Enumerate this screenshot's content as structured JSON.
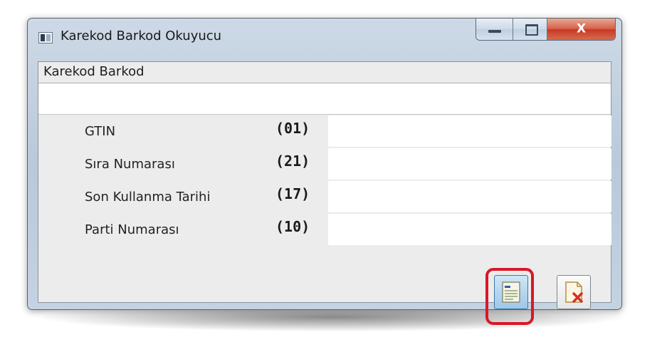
{
  "window": {
    "title": "Karekod Barkod Okuyucu",
    "icon": "app-window-icon",
    "controls": {
      "minimize_icon": "minimize-icon",
      "maximize_icon": "maximize-icon",
      "close_icon": "close-icon",
      "close_glyph": "X"
    }
  },
  "barcode_group": {
    "label": "Karekod Barkod",
    "input_value": ""
  },
  "fields": [
    {
      "label": "GTIN",
      "code": "(01)",
      "value": ""
    },
    {
      "label": "Sıra Numarası",
      "code": "(21)",
      "value": ""
    },
    {
      "label": "Son Kullanma Tarihi",
      "code": "(17)",
      "value": ""
    },
    {
      "label": "Parti Numarası",
      "code": "(10)",
      "value": ""
    }
  ],
  "buttons": {
    "read_icon": "document-list-icon",
    "cancel_icon": "document-cancel-icon"
  },
  "colors": {
    "highlight": "#d8172a",
    "close_button": "#c63a24",
    "chrome": "#c4d2e1"
  }
}
